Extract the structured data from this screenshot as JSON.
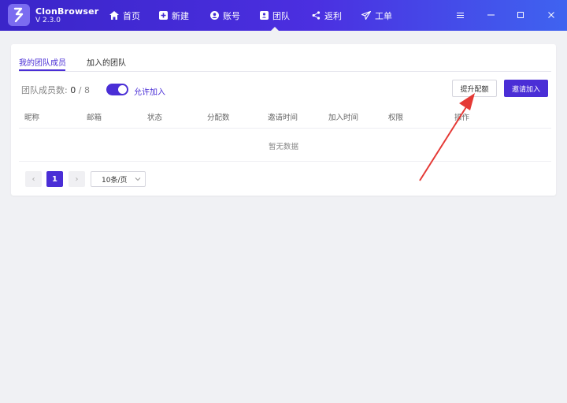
{
  "app": {
    "name": "ClonBrowser",
    "version": "V 2.3.0"
  },
  "nav": [
    {
      "key": "home",
      "label": "首页",
      "icon": "home-icon"
    },
    {
      "key": "new",
      "label": "新建",
      "icon": "plus-square-icon"
    },
    {
      "key": "accounts",
      "label": "账号",
      "icon": "user-circle-icon"
    },
    {
      "key": "team",
      "label": "团队",
      "icon": "team-badge-icon",
      "active": true
    },
    {
      "key": "rebate",
      "label": "返利",
      "icon": "share-icon"
    },
    {
      "key": "tickets",
      "label": "工单",
      "icon": "send-icon"
    }
  ],
  "window_controls": [
    "menu-icon",
    "minimize-icon",
    "maximize-icon",
    "close-icon"
  ],
  "tabs": [
    {
      "label": "我的团队成员",
      "active": true
    },
    {
      "label": "加入的团队",
      "active": false
    }
  ],
  "members": {
    "label": "团队成员数:",
    "current": "0",
    "separator": "/",
    "max": "8"
  },
  "allow_join": {
    "label": "允许加入",
    "enabled": true
  },
  "buttons": {
    "upgrade": "提升配额",
    "invite": "邀请加入"
  },
  "table": {
    "columns": [
      "昵称",
      "邮箱",
      "状态",
      "分配数",
      "邀请时间",
      "加入时间",
      "权限",
      "操作"
    ],
    "empty_text": "暂无数据"
  },
  "pagination": {
    "prev": "‹",
    "current": "1",
    "next": "›",
    "page_size": "10条/页"
  },
  "colors": {
    "brand": "#4a2ed6",
    "annotation_arrow": "#e53935"
  }
}
